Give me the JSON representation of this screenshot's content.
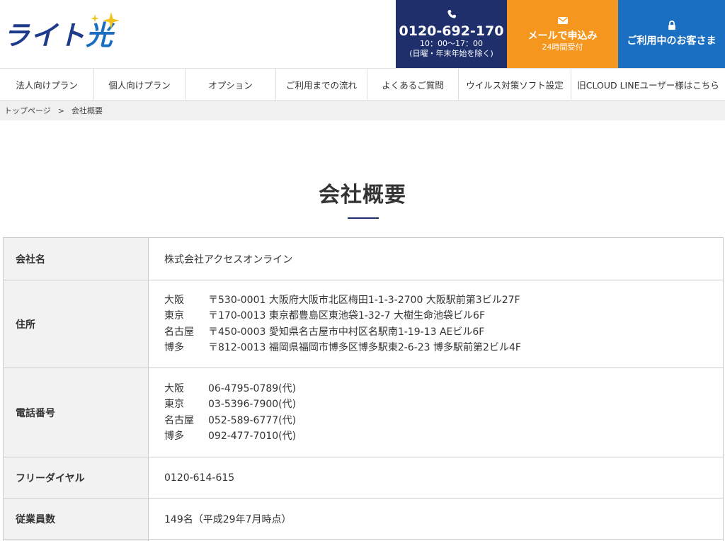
{
  "logo": {
    "text_main": "ライト",
    "text_accent": "光"
  },
  "cta": {
    "phone": {
      "number": "0120-692-170",
      "hours_line1": "10：00〜17：00",
      "hours_line2": "(日曜・年末年始を除く)"
    },
    "mail": {
      "label": "メールで申込み",
      "sub": "24時間受付"
    },
    "login": {
      "label": "ご利用中のお客さま"
    }
  },
  "nav": [
    "法人向けプラン",
    "個人向けプラン",
    "オプション",
    "ご利用までの流れ",
    "よくあるご質問",
    "ウイルス対策ソフト設定",
    "旧CLOUD LINEユーザー様はこちら"
  ],
  "breadcrumb": {
    "home": "トップページ",
    "separator": ">",
    "current": "会社概要"
  },
  "page_title": "会社概要",
  "company": {
    "name_label": "会社名",
    "name_value": "株式会社アクセスオンライン",
    "address_label": "住所",
    "addresses": [
      {
        "city": "大阪",
        "address": "〒530-0001 大阪府大阪市北区梅田1-1-3-2700 大阪駅前第3ビル27F"
      },
      {
        "city": "東京",
        "address": "〒170-0013 東京都豊島区東池袋1-32-7 大樹生命池袋ビル6F"
      },
      {
        "city": "名古屋",
        "address": "〒450-0003 愛知県名古屋市中村区名駅南1-19-13 AEビル6F"
      },
      {
        "city": "博多",
        "address": "〒812-0013 福岡県福岡市博多区博多駅東2-6-23 博多駅前第2ビル4F"
      }
    ],
    "tel_label": "電話番号",
    "tels": [
      {
        "city": "大阪",
        "tel": "06-4795-0789(代)"
      },
      {
        "city": "東京",
        "tel": "03-5396-7900(代)"
      },
      {
        "city": "名古屋",
        "tel": "052-589-6777(代)"
      },
      {
        "city": "博多",
        "tel": "092-477-7010(代)"
      }
    ],
    "freedial_label": "フリーダイヤル",
    "freedial_value": "0120-614-615",
    "employees_label": "従業員数",
    "employees_value": "149名（平成29年7月時点）"
  },
  "colors": {
    "navy": "#1e2f6b",
    "orange": "#f5961e",
    "blue": "#1a6fc2",
    "gold": "#f2c21b"
  },
  "icons": {
    "phone": "phone-icon",
    "mail": "mail-icon",
    "login": "lock-icon"
  }
}
